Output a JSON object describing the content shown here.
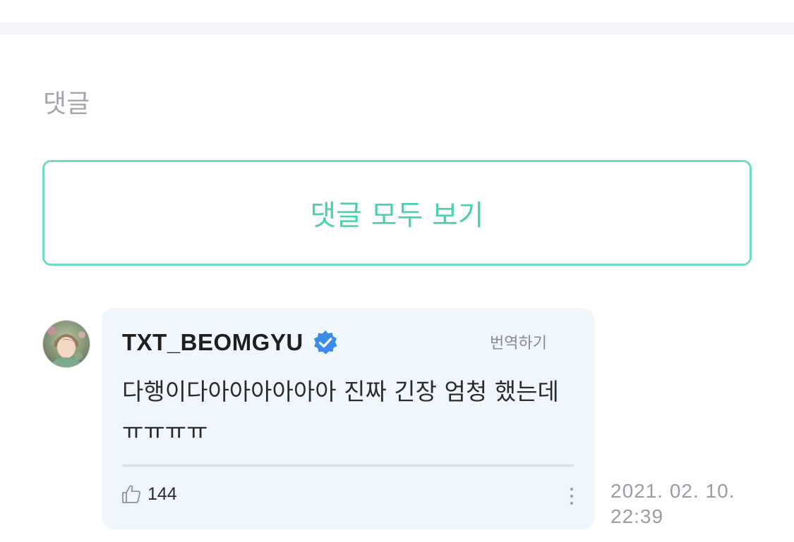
{
  "comments_section": {
    "title": "댓글",
    "view_all_label": "댓글 모두 보기"
  },
  "comment": {
    "author": "TXT_BEOMGYU",
    "verified": true,
    "translate_label": "번역하기",
    "text": "다행이다아아아아아아 진짜 긴장 엄청 했는데ㅠㅠㅠㅠ",
    "likes": "144",
    "timestamp": "2021. 02. 10. 22:39"
  },
  "icons": {
    "verified": "verified-check-icon",
    "like": "thumbs-up-icon",
    "more": "more-vertical-icon"
  },
  "colors": {
    "accent": "#6ddcc0",
    "accent_text": "#4ecfae",
    "card_background": "#eff7fd",
    "verified_blue": "#3b8beb",
    "muted_text": "#9a9da3"
  }
}
